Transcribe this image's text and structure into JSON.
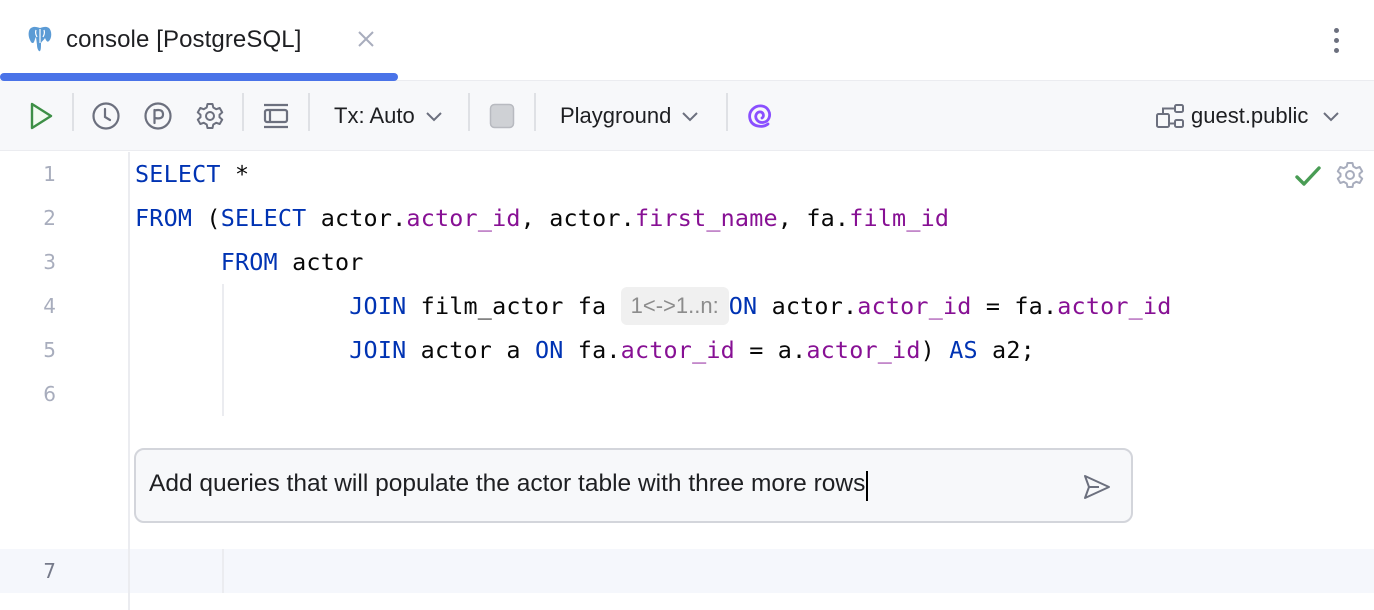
{
  "tab": {
    "title": "console [PostgreSQL]",
    "icon": "postgresql-elephant-icon",
    "close_icon": "close-icon",
    "active_color": "#4a73e8"
  },
  "window": {
    "more_icon": "more-vertical-icon"
  },
  "toolbar": {
    "run_icon": "run-icon",
    "history_icon": "history-clock-icon",
    "parameters_icon": "parameters-p-icon",
    "settings_icon": "gear-icon",
    "layout_icon": "layout-panel-icon",
    "tx_label": "Tx: Auto",
    "stop_icon": "stop-icon",
    "mode_label": "Playground",
    "ai_icon": "ai-assistant-spiral-icon",
    "schema_label": "guest.public",
    "schema_icon": "schema-icon"
  },
  "editor": {
    "status_icon": "check-icon",
    "status_color": "#499c54",
    "settings_icon": "gear-icon",
    "lines": [
      {
        "num": "1",
        "tokens": [
          {
            "t": "SELECT",
            "c": "kw"
          },
          {
            "t": " *",
            "c": ""
          }
        ]
      },
      {
        "num": "2",
        "tokens": [
          {
            "t": "FROM",
            "c": "kw"
          },
          {
            "t": " (",
            "c": ""
          },
          {
            "t": "SELECT",
            "c": "kw"
          },
          {
            "t": " actor.",
            "c": ""
          },
          {
            "t": "actor_id",
            "c": "fld"
          },
          {
            "t": ", actor.",
            "c": ""
          },
          {
            "t": "first_name",
            "c": "fld"
          },
          {
            "t": ", fa.",
            "c": ""
          },
          {
            "t": "film_id",
            "c": "fld"
          }
        ]
      },
      {
        "num": "3",
        "tokens": [
          {
            "t": "      ",
            "c": ""
          },
          {
            "t": "FROM",
            "c": "kw"
          },
          {
            "t": " actor",
            "c": ""
          }
        ]
      },
      {
        "num": "4",
        "tokens": [
          {
            "t": "               ",
            "c": ""
          },
          {
            "t": "JOIN",
            "c": "kw"
          },
          {
            "t": " film_actor fa ",
            "c": ""
          },
          {
            "t": "1<->1..n:",
            "c": "inlay"
          },
          {
            "t": "ON",
            "c": "kw"
          },
          {
            "t": " actor.",
            "c": ""
          },
          {
            "t": "actor_id",
            "c": "fld"
          },
          {
            "t": " = fa.",
            "c": ""
          },
          {
            "t": "actor_id",
            "c": "fld"
          }
        ]
      },
      {
        "num": "5",
        "tokens": [
          {
            "t": "               ",
            "c": ""
          },
          {
            "t": "JOIN",
            "c": "kw"
          },
          {
            "t": " actor a ",
            "c": ""
          },
          {
            "t": "ON",
            "c": "kw"
          },
          {
            "t": " fa.",
            "c": ""
          },
          {
            "t": "actor_id",
            "c": "fld"
          },
          {
            "t": " = a.",
            "c": ""
          },
          {
            "t": "actor_id",
            "c": "fld"
          },
          {
            "t": ") ",
            "c": ""
          },
          {
            "t": "AS",
            "c": "kw"
          },
          {
            "t": " a2;",
            "c": ""
          }
        ]
      },
      {
        "num": "6",
        "tokens": []
      }
    ],
    "current_line_num": "7"
  },
  "ai_prompt": {
    "value": "Add queries that will populate the actor table with three more rows",
    "send_icon": "send-icon"
  }
}
